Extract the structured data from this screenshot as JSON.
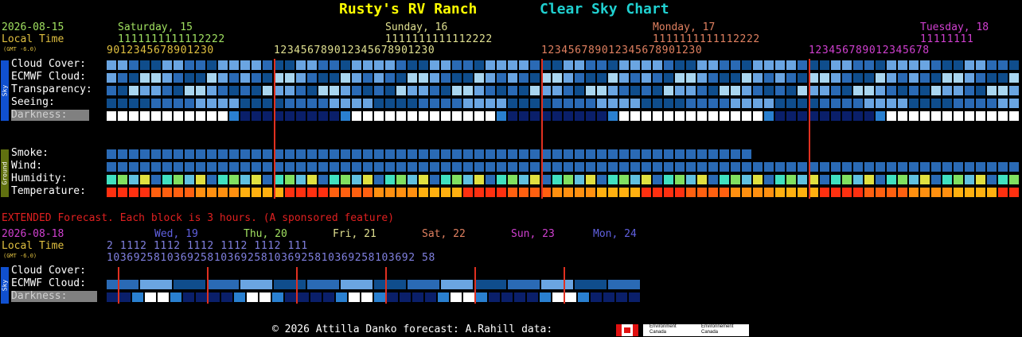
{
  "title": "Rusty's RV Ranch",
  "chart_title": "Clear Sky Chart",
  "colors": {
    "title": "#ffff00",
    "chart_title": "#20d0d0"
  },
  "main": {
    "date": "2026-08-15",
    "local_time_label": "Local Time",
    "gmt_label": "(GMT -6.0)",
    "days": [
      {
        "label": "Saturday, 15",
        "color": "#a0e060"
      },
      {
        "label": "Sunday, 16",
        "color": "#e0e090"
      },
      {
        "label": "Monday, 17",
        "color": "#e08060"
      },
      {
        "label": "Tuesday, 18",
        "color": "#d040d0"
      }
    ],
    "hour_row1_sat": "1111111111112222",
    "hour_row2_sat": "9012345678901230",
    "hour_row1_sun": "1111111111112222",
    "hour_row2_sun": "123456789012345678901230",
    "hour_row1_mon": "1111111111112222",
    "hour_row2_mon": "123456789012345678901230",
    "hour_row1_tue": "11111111",
    "hour_row2_tue": "123456789012345678",
    "sky_sidebar": "Sky",
    "ground_sidebar": "Ground",
    "rows": {
      "cloud": "Cloud Cover:",
      "ecmwf": "ECMWF Cloud:",
      "transparency": "Transparency:",
      "seeing": "Seeing:",
      "darkness": "Darkness:",
      "smoke": "Smoke:",
      "wind": "Wind:",
      "humidity": "Humidity:",
      "temperature": "Temperature:"
    }
  },
  "extended": {
    "heading": "EXTENDED Forecast. Each block is 3 hours. (A sponsored feature)",
    "date": "2026-08-18",
    "local_time_label": "Local Time",
    "gmt_label": "(GMT -6.0)",
    "days": [
      {
        "label": "Wed, 19",
        "color": "#6060e0"
      },
      {
        "label": "Thu, 20",
        "color": "#a0e060"
      },
      {
        "label": "Fri, 21",
        "color": "#e0e090"
      },
      {
        "label": "Sat, 22",
        "color": "#e08060"
      },
      {
        "label": "Sun, 23",
        "color": "#d040d0"
      },
      {
        "label": "Mon, 24",
        "color": "#6060e0"
      }
    ],
    "hour_row1": "2     1112     1112     1112     1112     1112     111",
    "hour_row2": "1036925810369258103692581036925810369258103692 58",
    "rows": {
      "cloud": "Cloud Cover:",
      "ecmwf": "ECMWF Cloud:",
      "darkness": "Darkness:"
    }
  },
  "footer": {
    "copyright": "© 2026 Attilla Danko  forecast: A.Rahill  data:",
    "logo_text_1": "Environment Canada",
    "logo_text_2": "Environnement Canada"
  }
}
